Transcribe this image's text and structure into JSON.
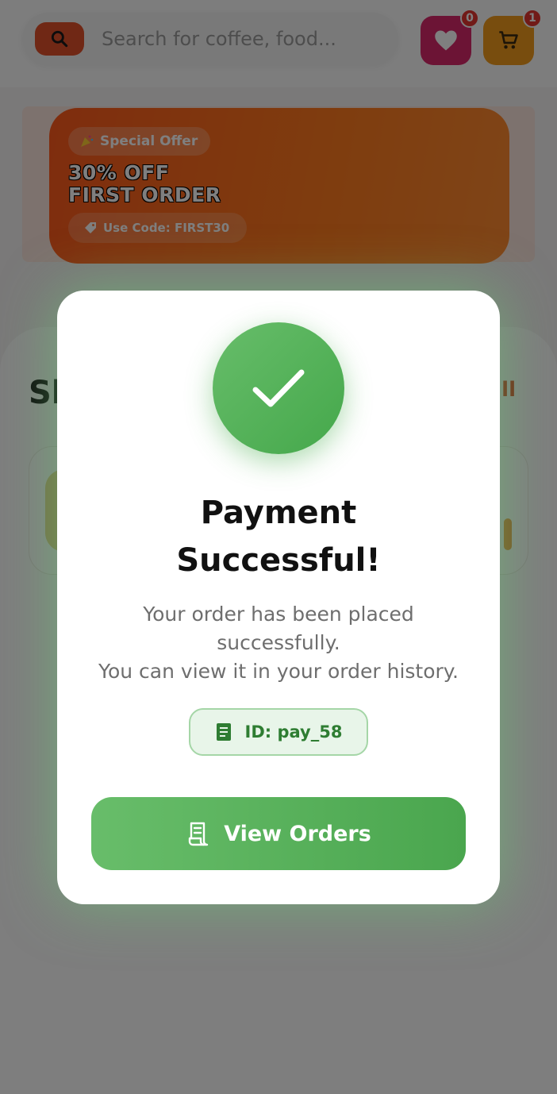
{
  "header": {
    "search": {
      "placeholder": "Search for coffee, food..."
    },
    "wishlist": {
      "count": "0"
    },
    "cart": {
      "count": "1"
    }
  },
  "promo": {
    "pill_label": "Special Offer",
    "title_line1": "30% OFF",
    "title_line2": "FIRST ORDER",
    "code_label": "Use Code: FIRST30"
  },
  "section": {
    "title": "Sl",
    "see_all": "ll"
  },
  "modal": {
    "title_line1": "Payment",
    "title_line2": "Successful!",
    "message_line1": "Your order has been placed",
    "message_line2": "successfully.",
    "message_line3": "You can view it in your order history.",
    "payment_id": "ID: pay_58",
    "button_label": "View Orders"
  },
  "colors": {
    "accent_orange": "#e0502a",
    "success_green": "#4caf50",
    "wishlist_pink": "#d8286a",
    "cart_orange": "#f19a1c"
  },
  "icons": [
    "search-icon",
    "heart-icon",
    "cart-icon",
    "tag-icon",
    "checkmark-icon",
    "receipt-icon"
  ]
}
